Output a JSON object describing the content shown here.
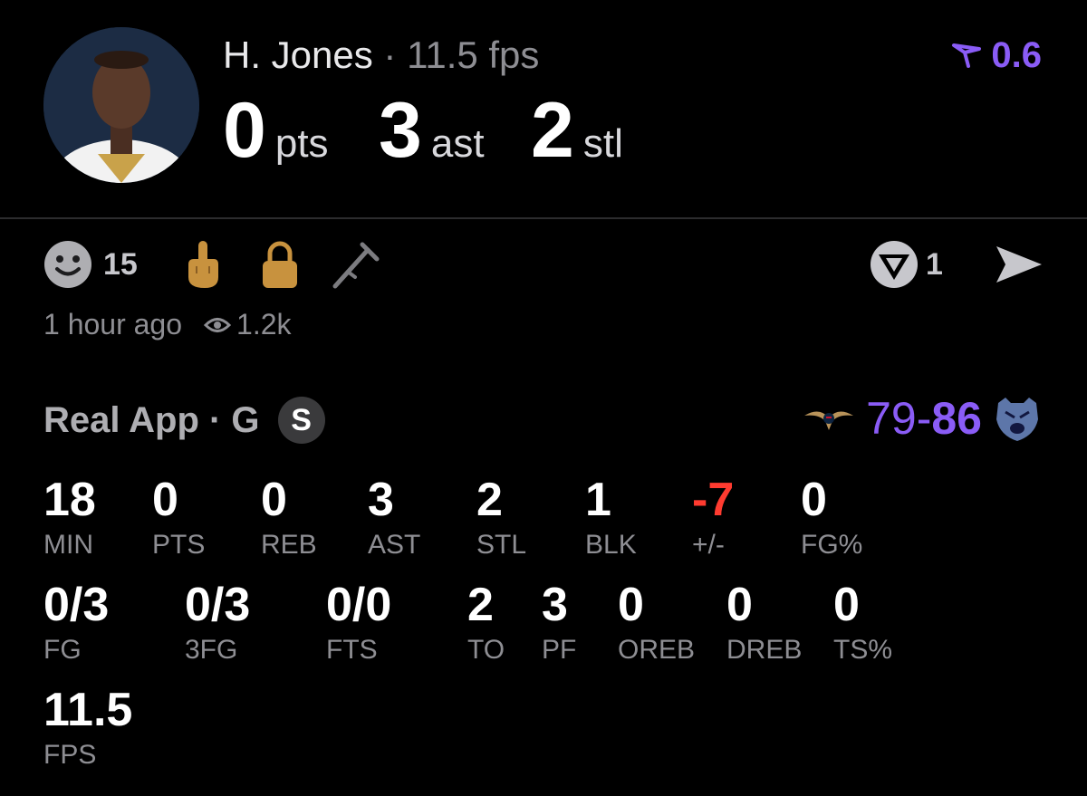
{
  "player": {
    "name": "H. Jones",
    "separator": "·",
    "fps_label": "11.5 fps",
    "headline": [
      {
        "value": "0",
        "unit": "pts"
      },
      {
        "value": "3",
        "unit": "ast"
      },
      {
        "value": "2",
        "unit": "stl"
      }
    ],
    "vote_score": "0.6"
  },
  "reactions": {
    "smile_count": "15",
    "comment_count": "1"
  },
  "meta": {
    "time_ago": "1 hour ago",
    "views": "1.2k"
  },
  "game": {
    "title": "Real App · G",
    "badge": "S",
    "score_away": "79",
    "score_dash": "-",
    "score_home": "86"
  },
  "stats_row1": [
    {
      "value": "18",
      "label": "MIN"
    },
    {
      "value": "0",
      "label": "PTS"
    },
    {
      "value": "0",
      "label": "REB"
    },
    {
      "value": "3",
      "label": "AST"
    },
    {
      "value": "2",
      "label": "STL"
    },
    {
      "value": "1",
      "label": "BLK"
    },
    {
      "value": "-7",
      "label": "+/-"
    },
    {
      "value": "0",
      "label": "FG%"
    }
  ],
  "stats_row2": [
    {
      "value": "0/3",
      "label": "FG"
    },
    {
      "value": "0/3",
      "label": "3FG"
    },
    {
      "value": "0/0",
      "label": "FTS"
    },
    {
      "value": "2",
      "label": "TO"
    },
    {
      "value": "3",
      "label": "PF"
    },
    {
      "value": "0",
      "label": "OREB"
    },
    {
      "value": "0",
      "label": "DREB"
    },
    {
      "value": "0",
      "label": "TS%"
    }
  ],
  "stats_row3": [
    {
      "value": "11.5",
      "label": "FPS"
    }
  ],
  "colors": {
    "accent": "#8a5cf6",
    "negative": "#ff3b30",
    "muted": "#8e8e93",
    "gold": "#c8923e"
  },
  "icons": [
    "smile-icon",
    "middle-finger-icon",
    "lock-icon",
    "crutch-icon",
    "real-logo-icon",
    "send-icon",
    "eye-icon",
    "pelicans-logo-icon",
    "grizzlies-logo-icon",
    "upvote-icon"
  ]
}
